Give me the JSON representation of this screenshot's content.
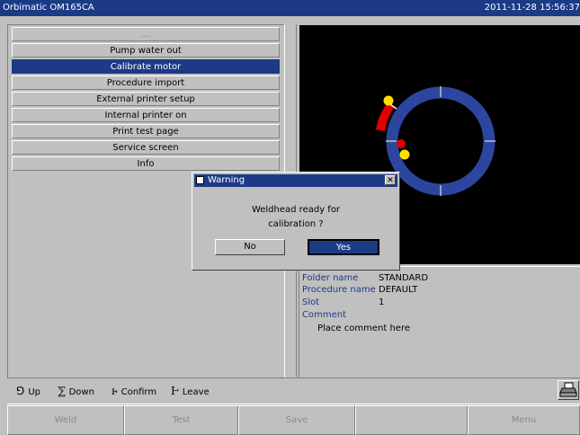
{
  "window": {
    "title": "Orbimatic OM165CA",
    "clock": "2011-11-28 15:56:37"
  },
  "menu": {
    "items": [
      {
        "label": "....",
        "selected": false
      },
      {
        "label": "Pump water out",
        "selected": false
      },
      {
        "label": "Calibrate motor",
        "selected": true
      },
      {
        "label": "Procedure import",
        "selected": false
      },
      {
        "label": "External printer setup",
        "selected": false
      },
      {
        "label": "Internal printer on",
        "selected": false
      },
      {
        "label": "Print test page",
        "selected": false
      },
      {
        "label": "Service screen",
        "selected": false
      },
      {
        "label": "Info",
        "selected": false
      }
    ]
  },
  "info": {
    "folder_label": "Folder name",
    "folder_value": "STANDARD",
    "procedure_label": "Procedure name",
    "procedure_value": "DEFAULT",
    "slot_label": "Slot",
    "slot_value": "1",
    "comment_label": "Comment",
    "comment_value": "Place comment here"
  },
  "status": {
    "up": "Up",
    "down": "Down",
    "confirm": "Confirm",
    "leave": "Leave"
  },
  "function_buttons": [
    "Weld",
    "Test",
    "Save",
    "",
    "Menu"
  ],
  "dialog": {
    "title": "Warning",
    "message_line1": "Weldhead ready for",
    "message_line2": "calibration ?",
    "no_label": "No",
    "yes_label": "Yes"
  },
  "colors": {
    "accent": "#1c3a86",
    "ring": "#2c46a0",
    "marker_red": "#e00000",
    "marker_yellow": "#ffe000"
  }
}
